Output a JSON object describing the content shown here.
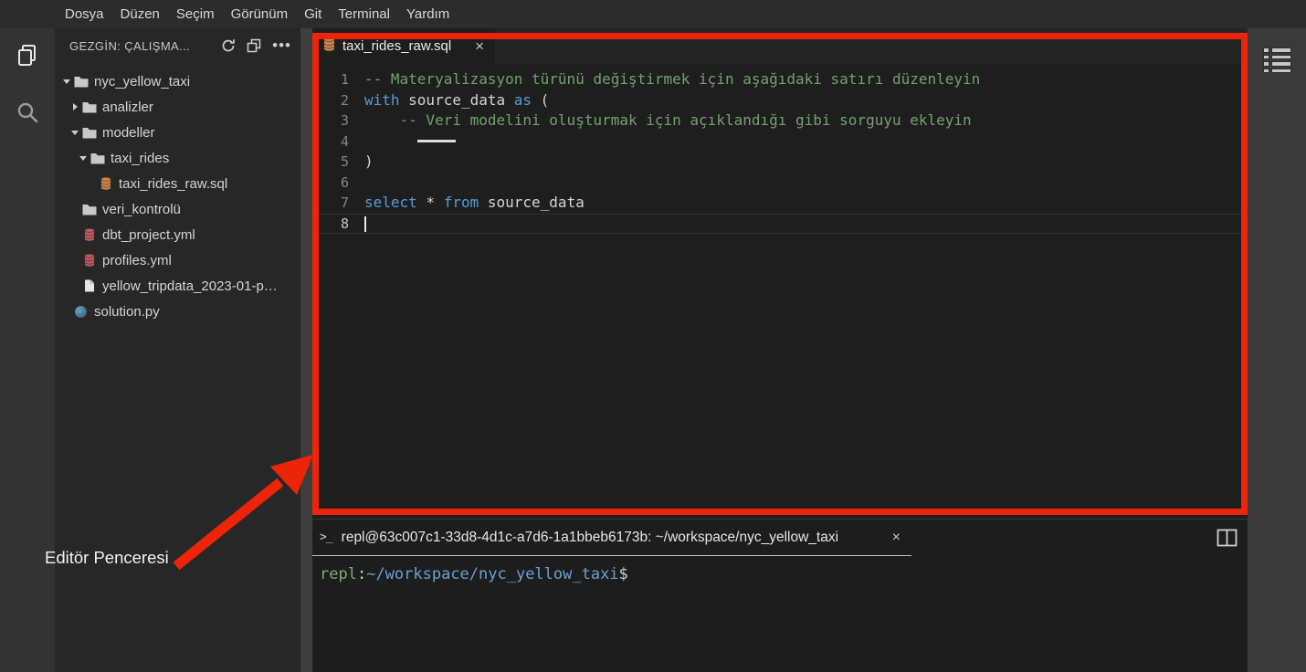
{
  "colors": {
    "annotation_red": "#ee2409",
    "keyword_blue": "#569cd6",
    "comment_green": "#74a06f",
    "prompt_user_green": "#7caf6c",
    "prompt_path_blue": "#6c9fd4"
  },
  "menu": {
    "items": [
      "Dosya",
      "Düzen",
      "Seçim",
      "Görünüm",
      "Git",
      "Terminal",
      "Yardım"
    ]
  },
  "activity_bar": {
    "items": [
      {
        "icon": "files-icon",
        "active": true
      },
      {
        "icon": "search-icon",
        "active": false
      }
    ]
  },
  "explorer": {
    "title": "GEZGİN: ÇALIŞMA...",
    "actions": [
      {
        "icon": "refresh-icon"
      },
      {
        "icon": "collapse-all-icon"
      },
      {
        "icon": "more-actions-icon"
      }
    ],
    "tree": [
      {
        "label": "nyc_yellow_taxi",
        "type": "folder",
        "arrow": "down",
        "level": 0
      },
      {
        "label": "analizler",
        "type": "folder",
        "arrow": "right",
        "level": 1
      },
      {
        "label": "modeller",
        "type": "folder",
        "arrow": "down",
        "level": 1
      },
      {
        "label": "taxi_rides",
        "type": "folder",
        "arrow": "down",
        "level": 2
      },
      {
        "label": "taxi_rides_raw.sql",
        "type": "sql",
        "arrow": "none",
        "level": 3
      },
      {
        "label": "veri_kontrolü",
        "type": "folder",
        "arrow": "none",
        "level": 1
      },
      {
        "label": "dbt_project.yml",
        "type": "yml",
        "arrow": "none",
        "level": 1
      },
      {
        "label": "profiles.yml",
        "type": "yml",
        "arrow": "none",
        "level": 1
      },
      {
        "label": "yellow_tripdata_2023-01-p…",
        "type": "file",
        "arrow": "none",
        "level": 1
      },
      {
        "label": "solution.py",
        "type": "py",
        "arrow": "none",
        "level": 0
      }
    ]
  },
  "editor": {
    "tab": {
      "label": "taxi_rides_raw.sql",
      "icon": "database-icon",
      "close_glyph": "×"
    },
    "lines": [
      {
        "num": "1",
        "tokens": [
          {
            "text": "-- Materyalizasyon türünü değiştirmek için aşağıdaki satırı düzenleyin",
            "type": "comment"
          }
        ]
      },
      {
        "num": "2",
        "tokens": [
          {
            "text": "with",
            "type": "keyword"
          },
          {
            "text": " source_data ",
            "type": "plain"
          },
          {
            "text": "as",
            "type": "keyword"
          },
          {
            "text": " (",
            "type": "plain"
          }
        ]
      },
      {
        "num": "3",
        "tokens": [
          {
            "text": "    -- Veri modelini oluşturmak için açıklandığı gibi sorguyu ekleyin",
            "type": "comment"
          }
        ]
      },
      {
        "num": "4",
        "tokens": [
          {
            "text": "      ",
            "type": "plain"
          }
        ],
        "placeholder_rule": true
      },
      {
        "num": "5",
        "tokens": [
          {
            "text": ")",
            "type": "plain"
          }
        ]
      },
      {
        "num": "6",
        "tokens": []
      },
      {
        "num": "7",
        "tokens": [
          {
            "text": "select",
            "type": "keyword"
          },
          {
            "text": " * ",
            "type": "plain"
          },
          {
            "text": "from",
            "type": "keyword"
          },
          {
            "text": " source_data",
            "type": "plain"
          }
        ]
      },
      {
        "num": "8",
        "tokens": [],
        "current": true,
        "cursor": true
      }
    ]
  },
  "terminal": {
    "icon": "terminal-prompt-icon",
    "tab_title": "repl@63c007c1-33d8-4d1c-a7d6-1a1bbeb6173b: ~/workspace/nyc_yellow_taxi",
    "close_glyph": "×",
    "actions": [
      {
        "icon": "split-panel-icon"
      }
    ],
    "prompt": [
      {
        "text": "repl",
        "type": "user"
      },
      {
        "text": ":",
        "type": "plain"
      },
      {
        "text": "~/workspace/nyc_yellow_taxi",
        "type": "path"
      },
      {
        "text": "$",
        "type": "plain"
      }
    ]
  },
  "right_strip": {
    "icon": "detail-list-icon"
  },
  "annotation": {
    "label": "Editör Penceresi"
  }
}
